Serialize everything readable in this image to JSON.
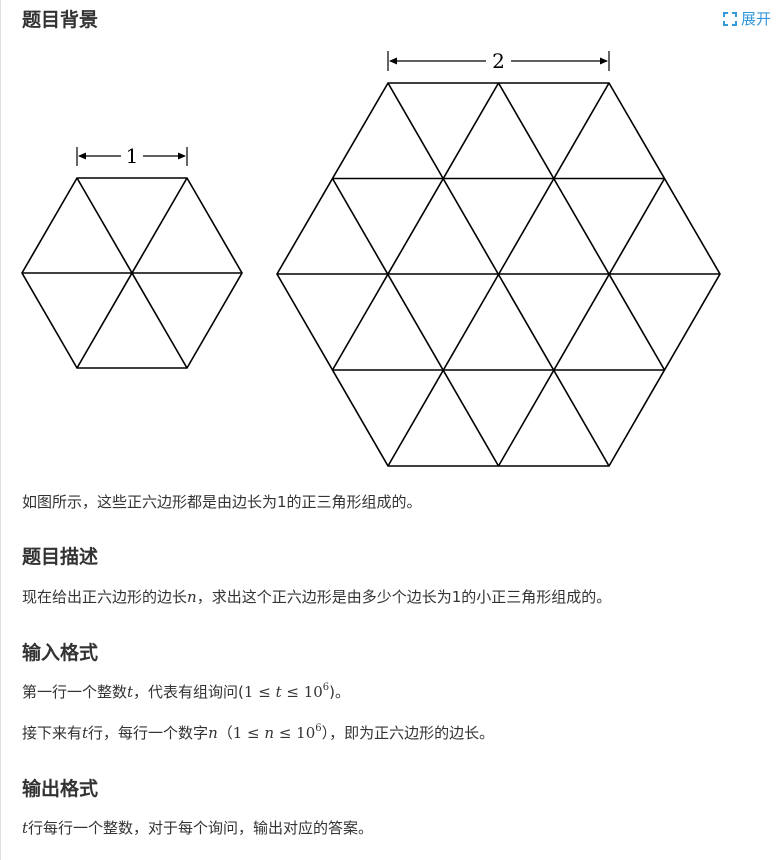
{
  "background": {
    "title": "题目背景",
    "expand_label": "展开",
    "figure": {
      "small_label": "1",
      "large_label": "2"
    },
    "caption": "如图所示，这些正六边形都是由边长为1的正三角形组成的。"
  },
  "description": {
    "title": "题目描述",
    "text_before": "现在给出正六边形的边长",
    "var_n": "n",
    "text_after": "，求出这个正六边形是由多少个边长为1的小正三角形组成的。"
  },
  "input_format": {
    "title": "输入格式",
    "line1": {
      "before": "第一行一个整数",
      "var_t": "t",
      "middle": "，代表有组询问(",
      "math_lhs": "1 ≤ ",
      "math_var": "t",
      "math_rhs": " ≤ 10",
      "exp": "6",
      "after": ")。"
    },
    "line2": {
      "before": "接下来有",
      "var_t": "t",
      "middle": "行，每行一个数字",
      "var_n": "n",
      "paren_open": "（",
      "math_lhs": "1 ≤ ",
      "math_var": "n",
      "math_rhs": " ≤ 10",
      "exp": "6",
      "paren_close": "）",
      "after": "，即为正六边形的边长。"
    }
  },
  "output_format": {
    "title": "输出格式",
    "var_t": "t",
    "text": "行每行一个整数，对于每个询问，输出对应的答案。"
  },
  "colors": {
    "text": "#333333",
    "link": "#3498db",
    "figure_stroke": "#000000"
  }
}
